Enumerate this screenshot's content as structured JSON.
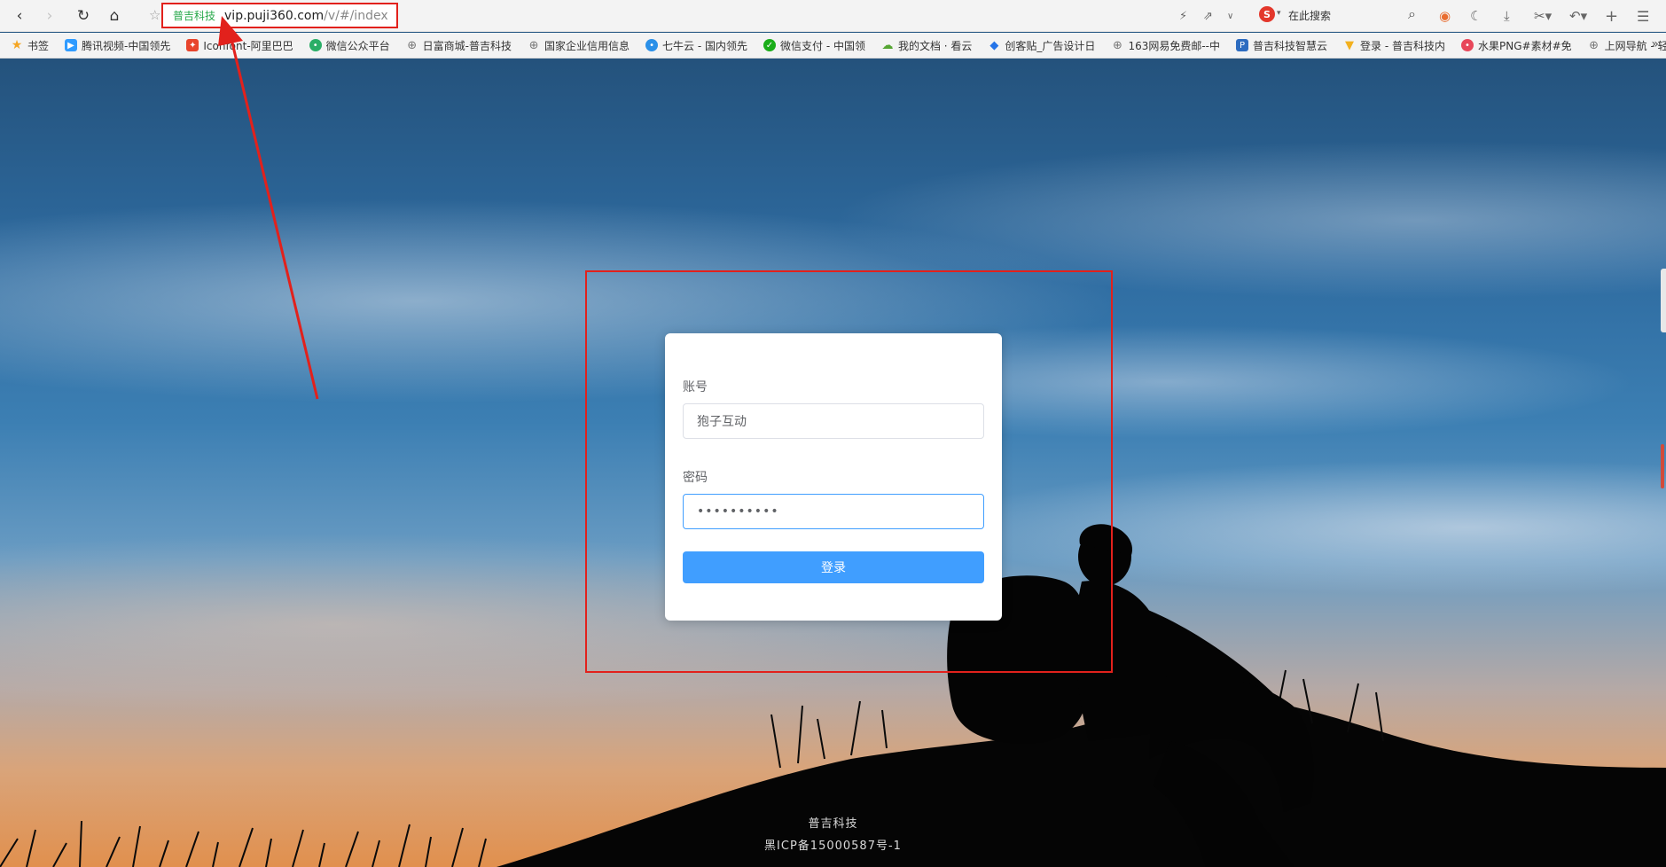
{
  "browser": {
    "address_site": "普吉科技",
    "address_url_host": "vip.puji360.com",
    "address_url_path": "/v/#/index",
    "search_placeholder": "在此搜索",
    "search_engine_letter": "S"
  },
  "bookmarks": [
    {
      "label": "书签",
      "icon": "star-icon",
      "color": "#f5a623"
    },
    {
      "label": "腾讯视频-中国领先",
      "icon": "tencent-video-icon",
      "color": "#2f9bff"
    },
    {
      "label": "Iconfont-阿里巴巴",
      "icon": "iconfont-icon",
      "color": "#e8452c"
    },
    {
      "label": "微信公众平台",
      "icon": "wechat-icon",
      "color": "#2aae67"
    },
    {
      "label": "日富商城-普吉科技",
      "icon": "globe-icon",
      "color": "#888888"
    },
    {
      "label": "国家企业信用信息",
      "icon": "globe-icon",
      "color": "#888888"
    },
    {
      "label": "七牛云 - 国内领先",
      "icon": "qiniu-icon",
      "color": "#2b90e8"
    },
    {
      "label": "微信支付 - 中国领",
      "icon": "wechat-pay-icon",
      "color": "#1aad19"
    },
    {
      "label": "我的文档 · 看云",
      "icon": "kancloud-icon",
      "color": "#55a532"
    },
    {
      "label": "创客贴_广告设计日",
      "icon": "chuangkit-icon",
      "color": "#2574e8"
    },
    {
      "label": "163网易免费邮--中",
      "icon": "globe-icon",
      "color": "#888888"
    },
    {
      "label": "普吉科技智慧云",
      "icon": "puji-icon",
      "color": "#2d6cc0"
    },
    {
      "label": "登录 - 普吉科技内",
      "icon": "login-icon",
      "color": "#f2b01e"
    },
    {
      "label": "水果PNG#素材#免",
      "icon": "fruit-icon",
      "color": "#e8475a"
    },
    {
      "label": "上网导航 - 轻快",
      "icon": "globe-icon",
      "color": "#888888"
    }
  ],
  "login": {
    "account_label": "账号",
    "account_value": "狍子互动",
    "password_label": "密码",
    "password_value": "••••••••••",
    "submit_label": "登录"
  },
  "footer": {
    "company": "普吉科技",
    "icp": "黑ICP备15000587号-1"
  },
  "colors": {
    "primary": "#409eff",
    "annotation": "#e2211c",
    "site_green": "#27a84a"
  }
}
